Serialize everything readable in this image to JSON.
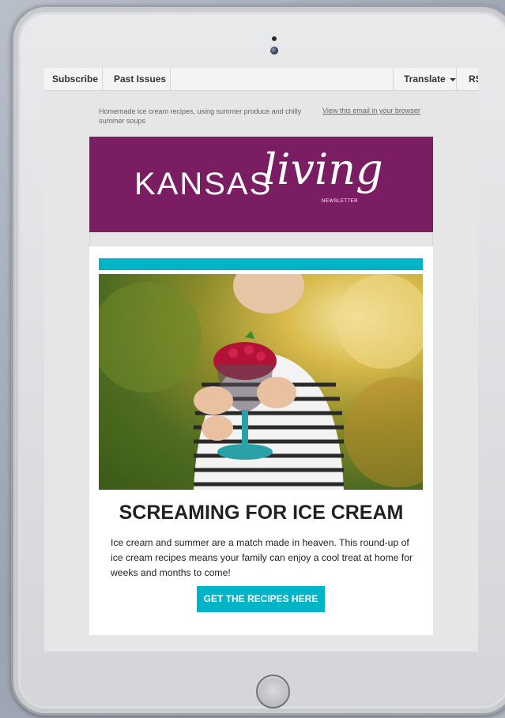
{
  "topbar": {
    "subscribe": "Subscribe",
    "past_issues": "Past Issues",
    "translate": "Translate",
    "rss": "RS"
  },
  "preheader": {
    "text": "Homemade ice cream recipes, using summer produce and chilly summer soups",
    "view_link": "View this email in your browser"
  },
  "banner": {
    "word1": "KANSAS",
    "word2": "living",
    "tagline": "NEWSLETTER",
    "color": "#7b1d63"
  },
  "article": {
    "title": "SCREAMING FOR ICE CREAM",
    "body": "Ice cream and summer are a match made in heaven. This round-up of ice cream recipes means your family can enjoy a cool treat at home for weeks and months to come!",
    "cta": "GET THE RECIPES HERE",
    "accent": "#00b4c8"
  }
}
